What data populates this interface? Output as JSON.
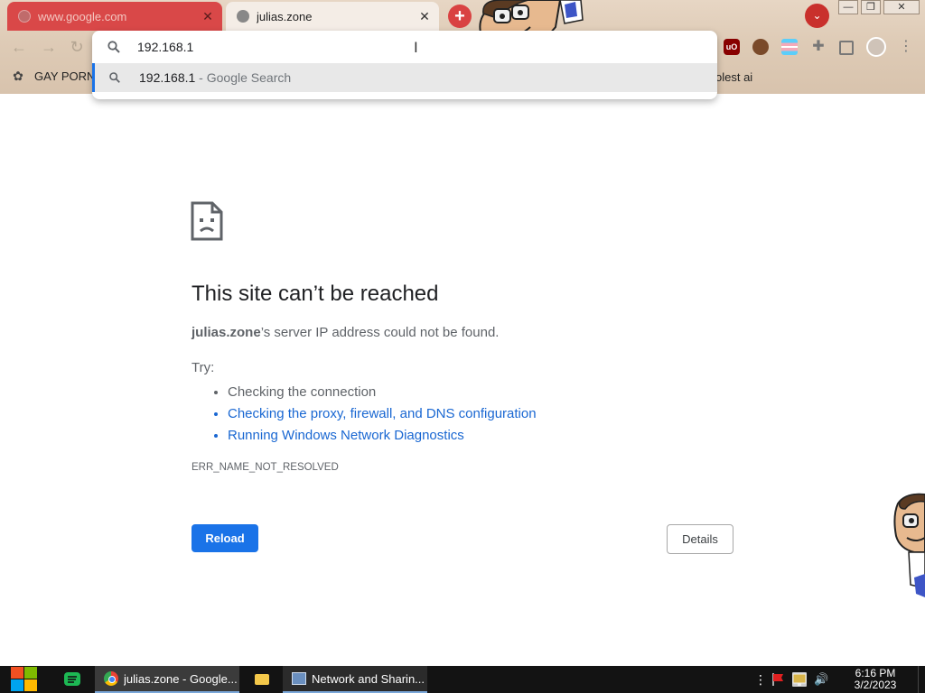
{
  "browser": {
    "tabs": [
      {
        "title": "www.google.com",
        "favicon": "globe-icon",
        "close": "✕"
      },
      {
        "title": "julias.zone",
        "favicon": "globe-icon",
        "close": "✕"
      }
    ],
    "new_tab": "+",
    "tab_search": "⌄",
    "window_controls": {
      "minimize": "—",
      "restore": "❐",
      "close": "✕"
    },
    "toolbar_icons": [
      "back-arrow-icon",
      "forward-arrow-icon",
      "reload-icon",
      "ublock-icon",
      "avatar-extension-icon",
      "flag-extension-icon",
      "extensions-icon",
      "side-panel-icon",
      "profile-icon",
      "menu-icon"
    ],
    "bookmarks": {
      "left": "GAY PORN",
      "right": "olest ai"
    },
    "accent_color": "#1a73e8"
  },
  "omnibox": {
    "input_value": "192.168.1",
    "cursor_glyph": "I",
    "suggestion": {
      "query": "192.168.1",
      "separator": " - ",
      "hint": "Google Search"
    }
  },
  "page": {
    "heading": "This site can’t be reached",
    "message": {
      "host": "julias.zone",
      "rest": "’s server IP address could not be found."
    },
    "try_label": "Try:",
    "suggestions": [
      {
        "text": "Checking the connection",
        "link": false
      },
      {
        "text": "Checking the proxy, firewall, and DNS configuration",
        "link": true
      },
      {
        "text": "Running Windows Network Diagnostics",
        "link": true
      }
    ],
    "error_code": "ERR_NAME_NOT_RESOLVED",
    "reload_label": "Reload",
    "details_label": "Details"
  },
  "taskbar": {
    "items": [
      {
        "label": "julias.zone - Google...",
        "icon": "chrome-icon"
      },
      {
        "label": "",
        "icon": "folder-icon"
      },
      {
        "label": "Network and Sharin...",
        "icon": "network-center-icon"
      }
    ],
    "tray": {
      "overflow": "⋮",
      "volume": "🔊"
    },
    "clock": {
      "time": "6:16 PM",
      "date": "3/2/2023"
    }
  }
}
